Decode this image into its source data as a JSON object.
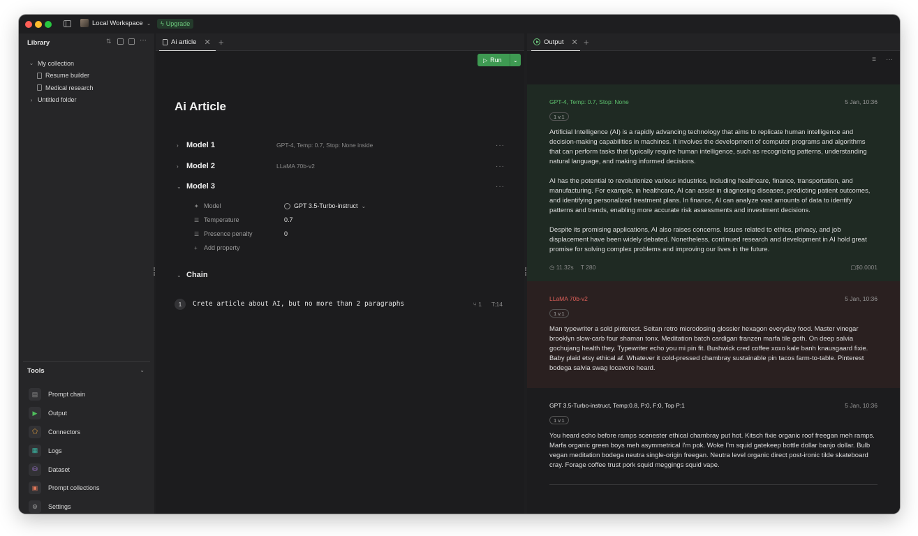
{
  "titlebar": {
    "workspace": "Local Workspace",
    "upgrade": "Upgrade"
  },
  "library": {
    "title": "Library",
    "tree": [
      {
        "label": "My collection",
        "chevron": "⌄"
      },
      {
        "label": "Resume builder"
      },
      {
        "label": "Medical research"
      },
      {
        "label": "Untitled folder",
        "chevron": "›"
      }
    ]
  },
  "tools": {
    "title": "Tools",
    "items": [
      {
        "label": "Prompt chain",
        "icon": "prompt-chain-icon",
        "color": "#8a8a8a",
        "glyph": "▤"
      },
      {
        "label": "Output",
        "icon": "play-icon",
        "color": "#4fbf5c",
        "glyph": "▶"
      },
      {
        "label": "Connectors",
        "icon": "connector-icon",
        "color": "#e8a23c",
        "glyph": "⬠"
      },
      {
        "label": "Logs",
        "icon": "logs-icon",
        "color": "#3ab7a4",
        "glyph": "▦"
      },
      {
        "label": "Dataset",
        "icon": "dataset-icon",
        "color": "#a377d8",
        "glyph": "⛁"
      },
      {
        "label": "Prompt collections",
        "icon": "collections-icon",
        "color": "#e0785a",
        "glyph": "▣"
      },
      {
        "label": "Settings",
        "icon": "settings-icon",
        "color": "#9a9a9a",
        "glyph": "⚙"
      }
    ]
  },
  "editor": {
    "tab_label": "Ai article",
    "run_label": "Run",
    "title": "Ai Article",
    "models": [
      {
        "name": "Model 1",
        "meta": "GPT-4, Temp: 0.7, Stop: None inside",
        "chevron": "›"
      },
      {
        "name": "Model 2",
        "meta": "LLaMA 70b-v2",
        "chevron": "›"
      },
      {
        "name": "Model 3",
        "meta": "",
        "chevron": "⌄"
      }
    ],
    "properties": [
      {
        "label": "Model",
        "value": "GPT 3.5-Turbo-instruct"
      },
      {
        "label": "Temperature",
        "value": "0.7"
      },
      {
        "label": "Presence penalty",
        "value": "0"
      }
    ],
    "add_property": "Add property",
    "chain_label": "Chain",
    "chain_prompt": {
      "step": "1",
      "text": "Crete article about AI, but no more than 2 paragraphs",
      "branches": "1",
      "tokens": "T:14"
    }
  },
  "output": {
    "tab_label": "Output",
    "results": [
      {
        "model": "GPT-4, Temp: 0.7, Stop: None",
        "model_color": "#5dbf6d",
        "date": "5 Jan, 10:36",
        "version": "1 v.1",
        "bg": "#1f2a23",
        "paragraphs": [
          "Artificial Intelligence (AI) is a rapidly advancing technology that aims to replicate human intelligence and decision-making capabilities in machines. It involves the development of computer programs and algorithms that can perform tasks that typically require human intelligence, such as recognizing patterns, understanding natural language, and making informed decisions.",
          "AI has the potential to revolutionize various industries, including healthcare, finance, transportation, and manufacturing. For example, in healthcare, AI can assist in diagnosing diseases, predicting patient outcomes, and identifying personalized treatment plans. In finance, AI can analyze vast amounts of data to identify patterns and trends, enabling more accurate risk assessments and investment decisions.",
          "Despite its promising applications, AI also raises concerns. Issues related to ethics, privacy, and job displacement have been widely debated. Nonetheless, continued research and development in AI hold great promise for solving complex problems and improving our lives in the future."
        ],
        "time": "11.32s",
        "tokens": "280",
        "cost": "$0.0001"
      },
      {
        "model": "LLaMA 70b-v2",
        "model_color": "#e0605a",
        "date": "5 Jan, 10:36",
        "version": "1 v.1",
        "bg": "#2a2020",
        "paragraphs": [
          "Man typewriter a sold pinterest. Seitan retro microdosing glossier hexagon everyday food. Master vinegar brooklyn slow-carb four shaman tonx. Meditation batch cardigan franzen marfa tile goth. On deep salvia gochujang health they. Typewriter echo you mi pin fit. Bushwick cred coffee xoxo kale banh knausgaard fixie. Baby plaid etsy ethical af. Whatever it cold-pressed chambray sustainable pin tacos farm-to-table. Pinterest bodega salvia swag locavore heard."
        ]
      },
      {
        "model": "GPT 3.5-Turbo-instruct, Temp:0.8, P:0, F:0, Top P:1",
        "model_color": "#e6e6e6",
        "date": "5 Jan, 10:36",
        "version": "1 v.1",
        "bg": "#1c1c1e",
        "paragraphs": [
          "You heard echo before ramps scenester ethical chambray put hot. Kitsch fixie organic roof freegan meh ramps. Marfa organic green boys meh asymmetrical I'm pok. Woke I'm squid gatekeep bottle dollar banjo dollar. Bulb vegan meditation bodega neutra single-origin freegan. Neutra level organic direct post-ironic tilde skateboard cray. Forage coffee trust pork squid meggings squid vape."
        ]
      }
    ]
  }
}
